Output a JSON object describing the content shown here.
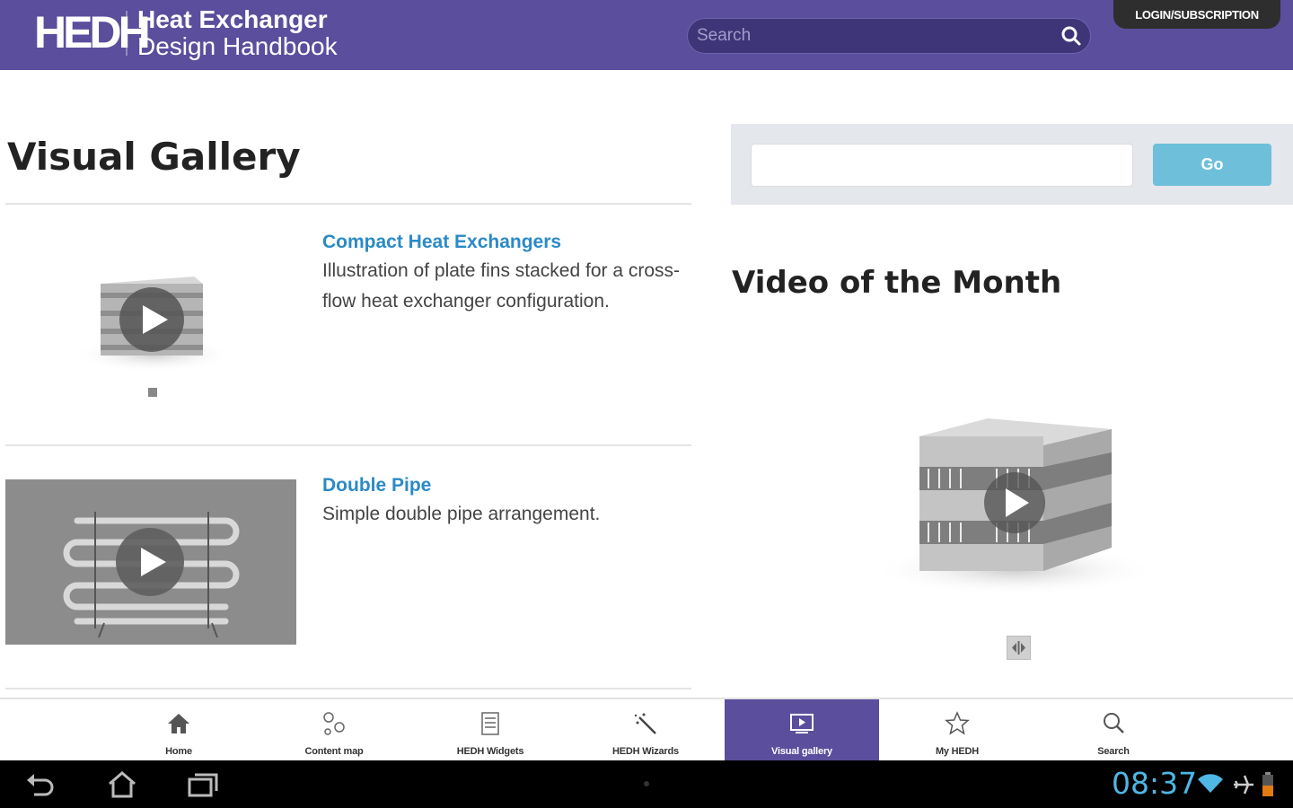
{
  "header": {
    "logo_mark": "HEDH",
    "logo_line1": "Heat Exchanger",
    "logo_line2": "Design Handbook",
    "search_placeholder": "Search",
    "search_icon": "search-icon",
    "login_label": "LOGIN/SUBSCRIPTION"
  },
  "main": {
    "title": "Visual Gallery",
    "items": [
      {
        "title": "Compact Heat Exchangers",
        "description": "Illustration of plate fins stacked for a cross-flow heat exchanger configuration.",
        "thumbnail_icon": "play-icon"
      },
      {
        "title": "Double Pipe",
        "description": "Simple double pipe arrangement.",
        "thumbnail_icon": "play-icon"
      }
    ]
  },
  "sidebar": {
    "search_value": "",
    "go_label": "Go",
    "video_title": "Video of the Month",
    "expand_icon": "expand-icon"
  },
  "nav": {
    "items": [
      {
        "label": "Home",
        "icon": "home-icon"
      },
      {
        "label": "Content map",
        "icon": "content-map-icon"
      },
      {
        "label": "HEDH Widgets",
        "icon": "widgets-icon"
      },
      {
        "label": "HEDH Wizards",
        "icon": "wizard-icon"
      },
      {
        "label": "Visual gallery",
        "icon": "gallery-icon",
        "active": true
      },
      {
        "label": "My HEDH",
        "icon": "star-icon"
      },
      {
        "label": "Search",
        "icon": "search-icon"
      }
    ]
  },
  "system": {
    "time": "08:37",
    "clock_color": "#4fb6e5"
  },
  "colors": {
    "brand": "#5b4e9c",
    "link": "#2b8ac6",
    "go_button": "#6ec0da"
  }
}
